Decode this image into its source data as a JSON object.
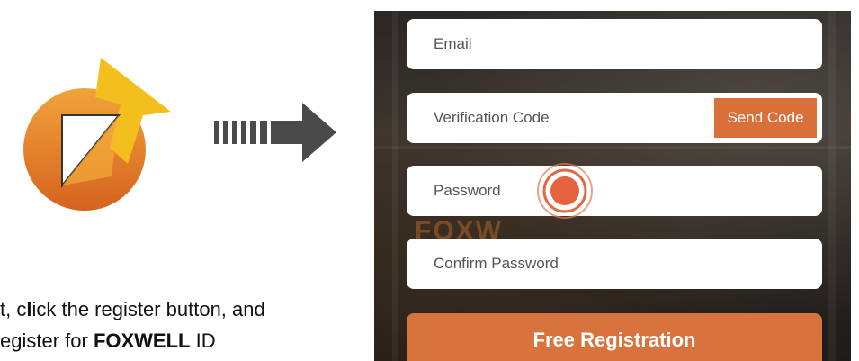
{
  "instruction": {
    "line1_prefix": "t, c",
    "line1_bold": "l",
    "line1_rest": "ick the register button, and",
    "line2_prefix": "egister for ",
    "line2_bold": "FOXWELL",
    "line2_rest": " ID"
  },
  "form": {
    "email_placeholder": "Email",
    "verification_placeholder": "Verification Code",
    "send_code_label": "Send Code",
    "password_placeholder": "Password",
    "confirm_password_placeholder": "Confirm Password",
    "register_button_label": "Free Registration"
  },
  "background_brand_text": "FOXW",
  "colors": {
    "accent": "#d9703a",
    "logo_orange": "#e6892f",
    "logo_yellow": "#f3bf1c",
    "arrow_gray": "#4a4a4a"
  },
  "icons": {
    "logo": "export-icon",
    "arrow": "arrow-right-icon",
    "tap": "tap-indicator-icon"
  }
}
